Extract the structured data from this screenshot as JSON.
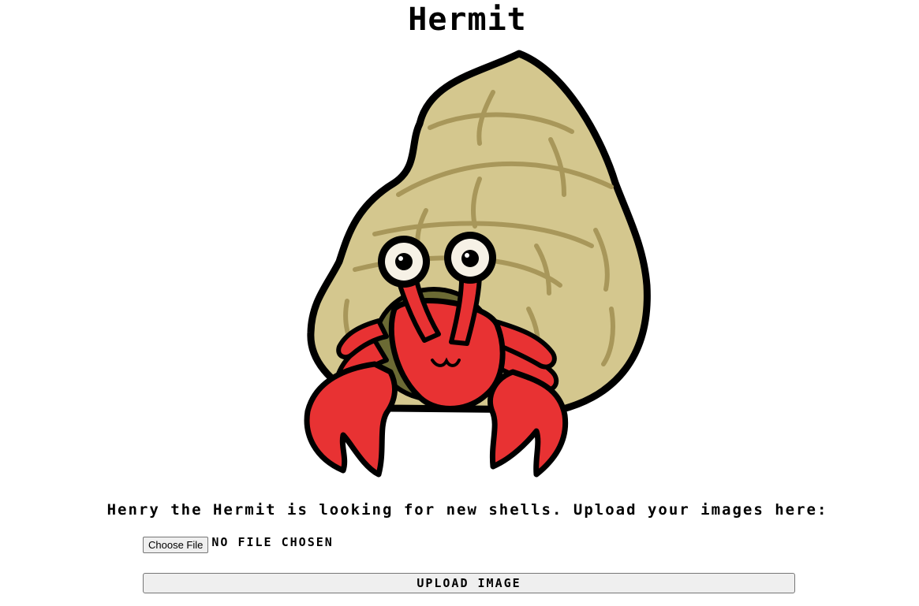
{
  "header": {
    "title": "Hermit"
  },
  "mascot": {
    "icon": "hermit-crab-illustration",
    "colors": {
      "shell": "#d4c78e",
      "shell_stripe": "#a8975a",
      "crab": "#e83233",
      "outline": "#000000",
      "inner_shell": "#6b6a34"
    }
  },
  "main": {
    "tagline": "Henry the Hermit is looking for new shells. Upload your images here:",
    "file_input": {
      "button_label": "Choose File",
      "status": "No file chosen"
    },
    "upload_button_label": "Upload Image"
  }
}
